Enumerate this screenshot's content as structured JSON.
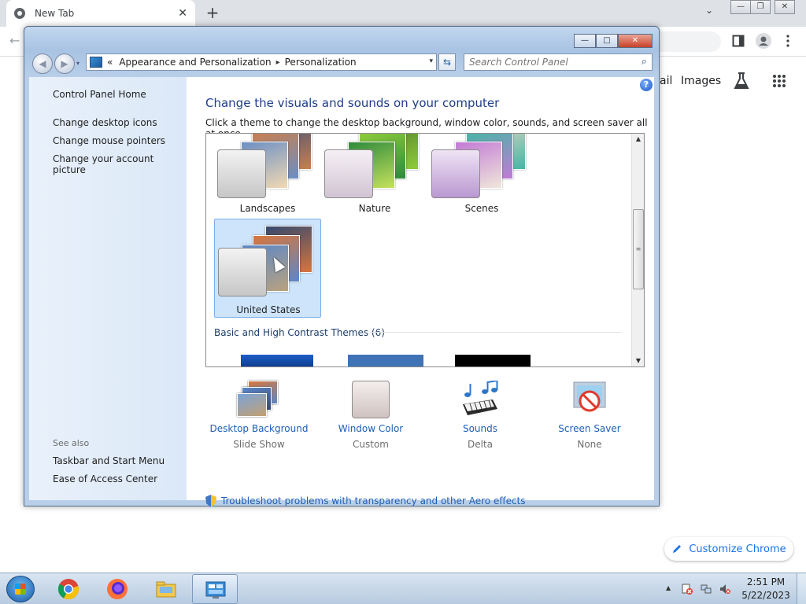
{
  "browser": {
    "tab_title": "New Tab",
    "tab_close": "✕",
    "new_tab": "+",
    "chevron": "⌄",
    "min": "—",
    "restore": "❐",
    "close": "✕",
    "back": "←",
    "ntp_links": [
      "ail",
      "Images"
    ],
    "customize_label": "Customize Chrome",
    "customize_icon": "pencil-icon"
  },
  "window": {
    "caption": {
      "min": "—",
      "max": "□",
      "close": "✕"
    },
    "nav": {
      "back": "◀",
      "forward": "▶",
      "dropdown": "▾"
    },
    "address": {
      "overflow": "«",
      "crumbs": [
        "Appearance and Personalization",
        "Personalization"
      ],
      "separator": "▸",
      "dropdown": "▾"
    },
    "refresh": "⇆",
    "search": {
      "placeholder": "Search Control Panel",
      "value": "",
      "icon": "⌕"
    },
    "help": "?"
  },
  "left_pane": {
    "home": "Control Panel Home",
    "links": [
      "Change desktop icons",
      "Change mouse pointers",
      "Change your account picture"
    ],
    "see_also_label": "See also",
    "see_also": [
      "Taskbar and Start Menu",
      "Ease of Access Center"
    ]
  },
  "main": {
    "title": "Change the visuals and sounds on your computer",
    "description": "Click a theme to change the desktop background, window color, sounds, and screen saver all at once.",
    "themes": [
      {
        "name": "Landscapes",
        "colors": [
          "#6b8fc4",
          "#c97f4e",
          "#3d4f7a"
        ]
      },
      {
        "name": "Nature",
        "colors": [
          "#2f8a3c",
          "#8fcc3a",
          "#4e7b2b"
        ]
      },
      {
        "name": "Scenes",
        "colors": [
          "#c27ad6",
          "#46b6a6",
          "#e7d6c2"
        ]
      },
      {
        "name": "United States",
        "colors": [
          "#d8763d",
          "#5c87c8",
          "#34496e"
        ]
      }
    ],
    "selected_theme": "United States",
    "basic_section": "Basic and High Contrast Themes (6)",
    "basic_colors": [
      "#1e5ec8",
      "#3f73b5",
      "#000000"
    ],
    "scroll": {
      "up": "▲",
      "down": "▼",
      "grip": "≡"
    },
    "customize": [
      {
        "label": "Desktop Background",
        "value": "Slide Show",
        "icon": "desktop-background-icon"
      },
      {
        "label": "Window Color",
        "value": "Custom",
        "icon": "window-color-icon"
      },
      {
        "label": "Sounds",
        "value": "Delta",
        "icon": "sounds-icon"
      },
      {
        "label": "Screen Saver",
        "value": "None",
        "icon": "screen-saver-icon"
      }
    ],
    "troubleshoot": "Troubleshoot problems with transparency and other Aero effects"
  },
  "taskbar": {
    "apps": [
      "chrome-icon",
      "firefox-icon",
      "file-explorer-icon",
      "control-panel-icon"
    ],
    "tray_up": "▲",
    "time": "2:51 PM",
    "date": "5/22/2023"
  }
}
